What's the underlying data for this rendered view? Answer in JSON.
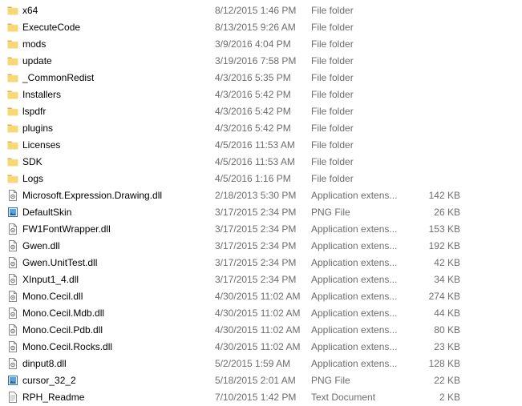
{
  "files": [
    {
      "name": "x64",
      "date": "8/12/2015 1:46 PM",
      "type": "File folder",
      "size": "",
      "icon": "folder-icon"
    },
    {
      "name": "ExecuteCode",
      "date": "8/13/2015 9:26 AM",
      "type": "File folder",
      "size": "",
      "icon": "folder-icon"
    },
    {
      "name": "mods",
      "date": "3/9/2016 4:04 PM",
      "type": "File folder",
      "size": "",
      "icon": "folder-icon"
    },
    {
      "name": "update",
      "date": "3/19/2016 7:58 PM",
      "type": "File folder",
      "size": "",
      "icon": "folder-icon"
    },
    {
      "name": "_CommonRedist",
      "date": "4/3/2016 5:35 PM",
      "type": "File folder",
      "size": "",
      "icon": "folder-icon"
    },
    {
      "name": "Installers",
      "date": "4/3/2016 5:42 PM",
      "type": "File folder",
      "size": "",
      "icon": "folder-icon"
    },
    {
      "name": "lspdfr",
      "date": "4/3/2016 5:42 PM",
      "type": "File folder",
      "size": "",
      "icon": "folder-icon"
    },
    {
      "name": "plugins",
      "date": "4/3/2016 5:42 PM",
      "type": "File folder",
      "size": "",
      "icon": "folder-icon"
    },
    {
      "name": "Licenses",
      "date": "4/5/2016 11:53 AM",
      "type": "File folder",
      "size": "",
      "icon": "folder-icon"
    },
    {
      "name": "SDK",
      "date": "4/5/2016 11:53 AM",
      "type": "File folder",
      "size": "",
      "icon": "folder-icon"
    },
    {
      "name": "Logs",
      "date": "4/5/2016 1:16 PM",
      "type": "File folder",
      "size": "",
      "icon": "folder-icon"
    },
    {
      "name": "Microsoft.Expression.Drawing.dll",
      "date": "2/18/2013 5:30 PM",
      "type": "Application extens...",
      "size": "142 KB",
      "icon": "dll-file-icon"
    },
    {
      "name": "DefaultSkin",
      "date": "3/17/2015 2:34 PM",
      "type": "PNG File",
      "size": "26 KB",
      "icon": "image-file-icon"
    },
    {
      "name": "FW1FontWrapper.dll",
      "date": "3/17/2015 2:34 PM",
      "type": "Application extens...",
      "size": "153 KB",
      "icon": "dll-file-icon"
    },
    {
      "name": "Gwen.dll",
      "date": "3/17/2015 2:34 PM",
      "type": "Application extens...",
      "size": "192 KB",
      "icon": "dll-file-icon"
    },
    {
      "name": "Gwen.UnitTest.dll",
      "date": "3/17/2015 2:34 PM",
      "type": "Application extens...",
      "size": "42 KB",
      "icon": "dll-file-icon"
    },
    {
      "name": "XInput1_4.dll",
      "date": "3/17/2015 2:34 PM",
      "type": "Application extens...",
      "size": "34 KB",
      "icon": "dll-file-icon"
    },
    {
      "name": "Mono.Cecil.dll",
      "date": "4/30/2015 11:02 AM",
      "type": "Application extens...",
      "size": "274 KB",
      "icon": "dll-file-icon"
    },
    {
      "name": "Mono.Cecil.Mdb.dll",
      "date": "4/30/2015 11:02 AM",
      "type": "Application extens...",
      "size": "44 KB",
      "icon": "dll-file-icon"
    },
    {
      "name": "Mono.Cecil.Pdb.dll",
      "date": "4/30/2015 11:02 AM",
      "type": "Application extens...",
      "size": "80 KB",
      "icon": "dll-file-icon"
    },
    {
      "name": "Mono.Cecil.Rocks.dll",
      "date": "4/30/2015 11:02 AM",
      "type": "Application extens...",
      "size": "23 KB",
      "icon": "dll-file-icon"
    },
    {
      "name": "dinput8.dll",
      "date": "5/2/2015 1:59 AM",
      "type": "Application extens...",
      "size": "128 KB",
      "icon": "dll-file-icon"
    },
    {
      "name": "cursor_32_2",
      "date": "5/18/2015 2:01 AM",
      "type": "PNG File",
      "size": "22 KB",
      "icon": "image-file-icon"
    },
    {
      "name": "RPH_Readme",
      "date": "7/10/2015 1:42 PM",
      "type": "Text Document",
      "size": "2 KB",
      "icon": "text-file-icon"
    }
  ],
  "colors": {
    "folder": "#f8d775",
    "folder_dark": "#dcb047",
    "meta_text": "#6d6d6d",
    "name_text": "#000000"
  }
}
